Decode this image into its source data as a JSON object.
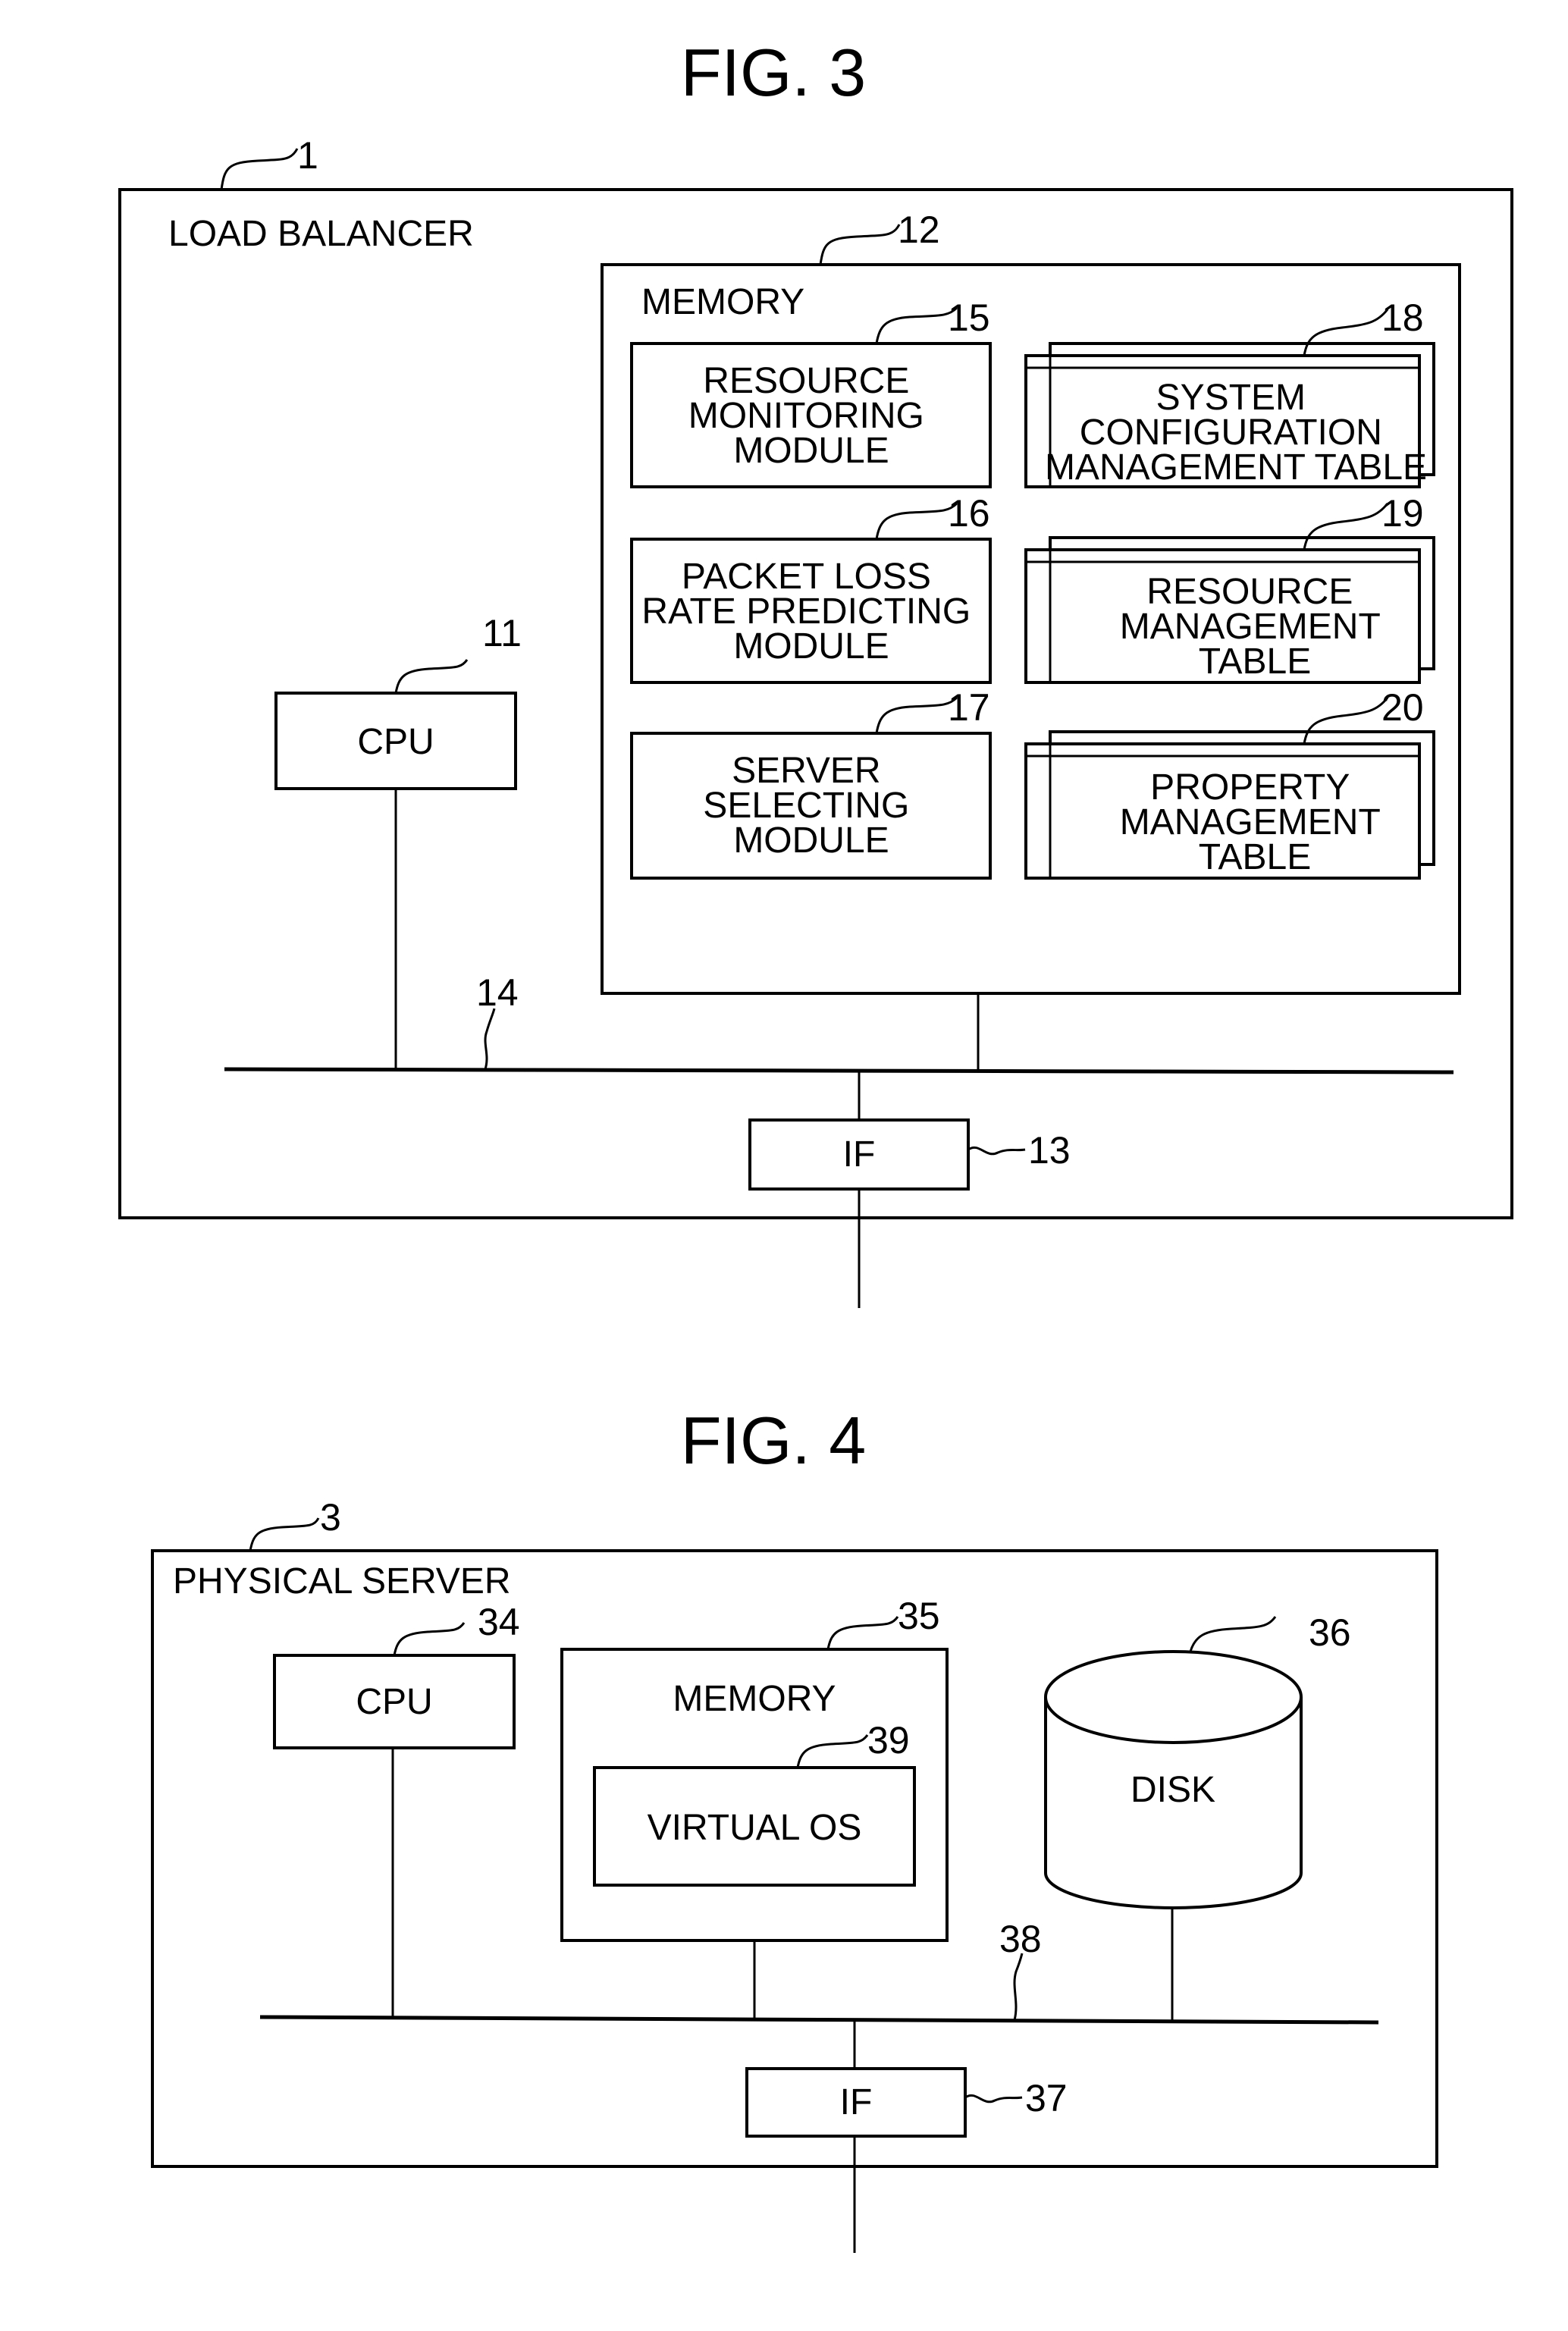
{
  "fig3": {
    "title": "FIG. 3",
    "load_balancer": {
      "ref": "1",
      "label": "LOAD BALANCER"
    },
    "memory": {
      "ref": "12",
      "label": "MEMORY"
    },
    "modules": [
      {
        "ref": "15",
        "lines": [
          "RESOURCE",
          "MONITORING",
          "MODULE"
        ]
      },
      {
        "ref": "16",
        "lines": [
          "PACKET LOSS",
          "RATE PREDICTING",
          "MODULE"
        ]
      },
      {
        "ref": "17",
        "lines": [
          "SERVER",
          "SELECTING",
          "MODULE"
        ]
      }
    ],
    "tables": [
      {
        "ref": "18",
        "lines": [
          "SYSTEM",
          "CONFIGURATION",
          "MANAGEMENT TABLE"
        ]
      },
      {
        "ref": "19",
        "lines": [
          "RESOURCE",
          "MANAGEMENT",
          "TABLE"
        ]
      },
      {
        "ref": "20",
        "lines": [
          "PROPERTY",
          "MANAGEMENT",
          "TABLE"
        ]
      }
    ],
    "cpu": {
      "ref": "11",
      "label": "CPU"
    },
    "bus": {
      "ref": "14"
    },
    "interface": {
      "ref": "13",
      "label": "IF"
    }
  },
  "fig4": {
    "title": "FIG. 4",
    "physical_server": {
      "ref": "3",
      "label": "PHYSICAL SERVER"
    },
    "cpu": {
      "ref": "34",
      "label": "CPU"
    },
    "memory": {
      "ref": "35",
      "label": "MEMORY"
    },
    "virtual_os": {
      "ref": "39",
      "label": "VIRTUAL OS"
    },
    "disk": {
      "ref": "36",
      "label": "DISK"
    },
    "bus": {
      "ref": "38"
    },
    "interface": {
      "ref": "37",
      "label": "IF"
    }
  }
}
